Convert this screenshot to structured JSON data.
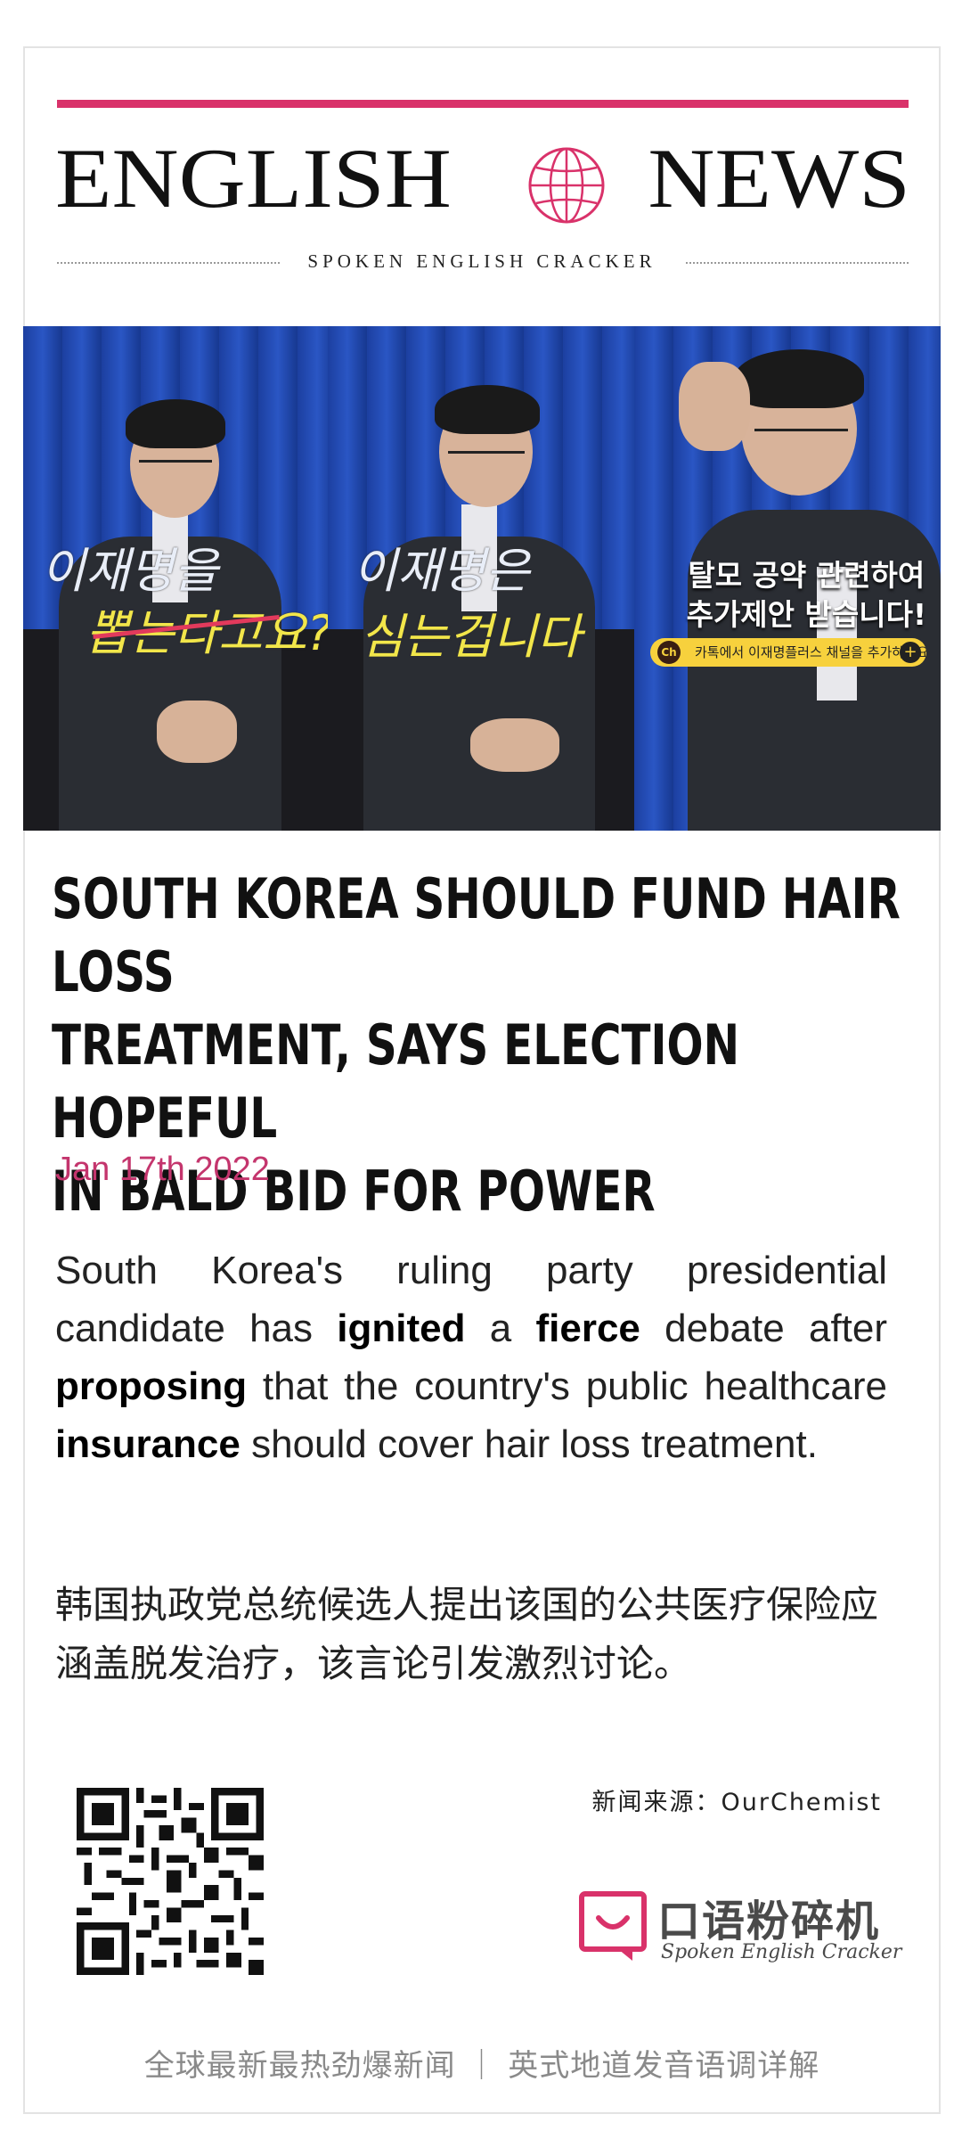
{
  "masthead": {
    "word_left": "ENGLISH",
    "word_right": "NEWS",
    "subtitle": "SPOKEN ENGLISH CRACKER",
    "accent_color": "#d9326a"
  },
  "photo": {
    "panel1_line1": "이재명을",
    "panel1_line2": "뽑는다고요?",
    "panel2_line1": "이재명은",
    "panel2_line2": "심는겁니다",
    "panel3_headline_1": "탈모 공약 관련하여",
    "panel3_headline_2": "추가제안 받습니다!",
    "panel3_pill": "카톡에서 이재명플러스 채널을 추가하세요",
    "panel3_pill_badge": "Ch"
  },
  "article": {
    "headline": "SOUTH KOREA SHOULD FUND HAIR LOSS TREATMENT, SAYS ELECTION HOPEFUL IN BALD BID FOR POWER",
    "headline_line1": "SOUTH KOREA SHOULD FUND HAIR LOSS",
    "headline_line2": "TREATMENT, SAYS ELECTION HOPEFUL",
    "headline_line3": "IN BALD BID FOR POWER",
    "date": "Jan 17th 2022",
    "date_color": "#c4356d",
    "body_en": {
      "t1": "South Korea's ruling party presidential candidate has ",
      "k1": "ignited",
      "t2": " a ",
      "k2": "fierce",
      "t3": " debate after ",
      "k3": "proposing",
      "t4": " that the country's public healthcare ",
      "k4": "insurance",
      "t5": " should cover hair loss treatment."
    },
    "body_cn": "韩国执政党总统候选人提出该国的公共医疗保险应涵盖脱发治疗，该言论引发激烈讨论。"
  },
  "footer_block": {
    "source": "新闻来源：OurChemist",
    "logo_cn": "口语粉碎机",
    "logo_en": "Spoken English Cracker",
    "tagline": "全球最新最热劲爆新闻 ｜ 英式地道发音语调详解"
  }
}
